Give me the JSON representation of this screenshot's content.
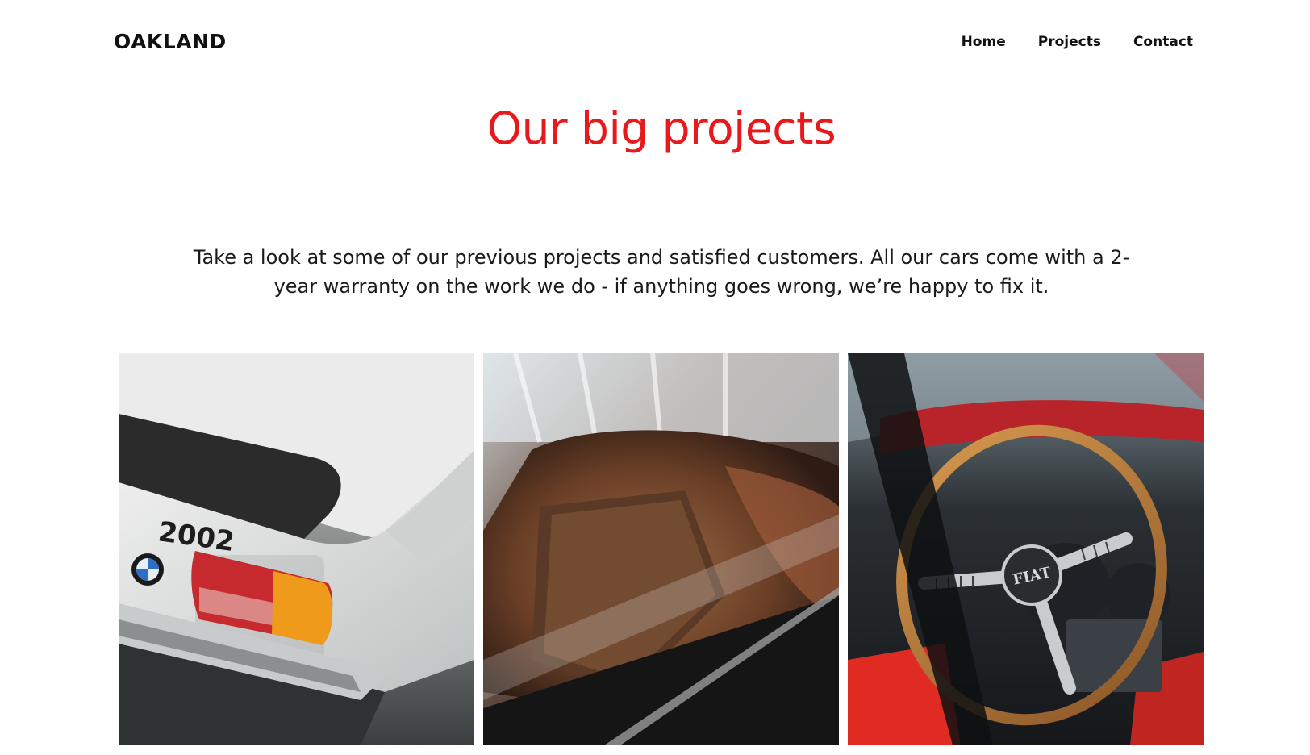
{
  "header": {
    "logo": "OAKLAND",
    "nav": [
      {
        "label": "Home"
      },
      {
        "label": "Projects"
      },
      {
        "label": "Contact"
      }
    ]
  },
  "main": {
    "title": "Our big projects",
    "intro_line1": "Take a look at some of our previous projects and satisfied customers. All our cars come with a 2-",
    "intro_line2": "year warranty on the work we do - if anything goes wrong, we’re happy to fix it."
  },
  "gallery": {
    "photos": [
      {
        "subject": "rear of a silver BMW 2002 with tail light",
        "badge_text": "2002",
        "emblem": "BMW"
      },
      {
        "subject": "brown leather car seat close-up"
      },
      {
        "subject": "wooden steering wheel of a red Fiat",
        "emblem": "FIAT"
      }
    ]
  },
  "colors": {
    "accent": "#e8191c",
    "text": "#111111",
    "background": "#ffffff"
  }
}
